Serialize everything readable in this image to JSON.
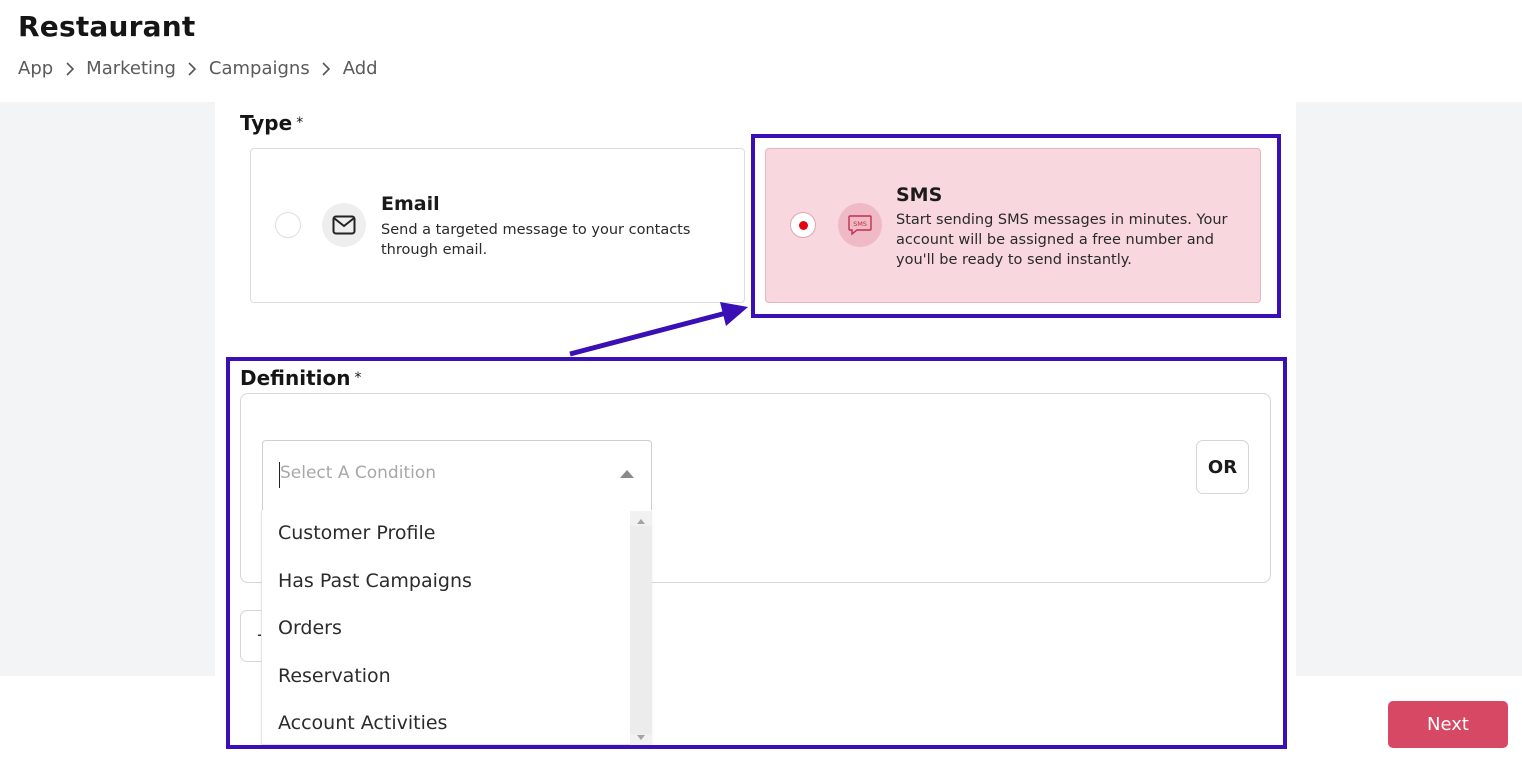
{
  "header": {
    "title": "Restaurant",
    "breadcrumb": [
      "App",
      "Marketing",
      "Campaigns",
      "Add"
    ]
  },
  "type_section": {
    "label": "Type",
    "required_mark": "*",
    "options": [
      {
        "title": "Email",
        "description": "Send a targeted message to your contacts through email.",
        "icon": "envelope-icon",
        "selected": false
      },
      {
        "title": "SMS",
        "description": "Start sending SMS messages in minutes. Your account will be assigned a free number and you'll be ready to send instantly.",
        "icon": "sms-bubble-icon",
        "icon_text": "SMS",
        "selected": true
      }
    ]
  },
  "definition_section": {
    "label": "Definition",
    "required_mark": "*",
    "condition_select": {
      "placeholder": "Select A Condition",
      "options": [
        "Customer Profile",
        "Has Past Campaigns",
        "Orders",
        "Reservation",
        "Account Activities"
      ]
    },
    "or_label": "OR",
    "add_label": "+"
  },
  "footer": {
    "next_label": "Next"
  },
  "colors": {
    "accent": "#d64863",
    "selected_card_bg": "#f8d7de",
    "annotation": "#3a0fb6",
    "radio_dot": "#e20613"
  }
}
